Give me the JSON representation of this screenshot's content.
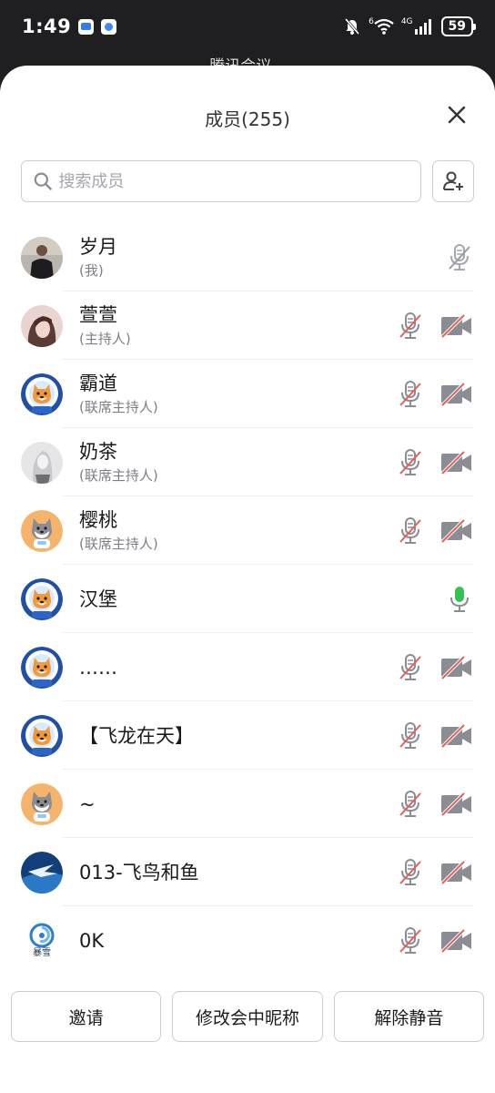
{
  "status_bar": {
    "time": "1:49",
    "net_label": "4G",
    "sim_label": "6",
    "battery": "59"
  },
  "behind_title": "腾讯会议",
  "sheet": {
    "title": "成员(255)",
    "search_placeholder": "搜索成员"
  },
  "members": [
    {
      "name": "岁月",
      "role": "(我)",
      "avatar": "photo-man",
      "mic": "muted-gray",
      "video": "none"
    },
    {
      "name": "萱萱",
      "role": "(主持人)",
      "avatar": "photo-girl",
      "mic": "muted",
      "video": "off"
    },
    {
      "name": "霸道",
      "role": "(联席主持人)",
      "avatar": "shiba-astronaut",
      "mic": "muted",
      "video": "off"
    },
    {
      "name": "奶茶",
      "role": "(联席主持人)",
      "avatar": "photo-gray",
      "mic": "muted",
      "video": "off"
    },
    {
      "name": "樱桃",
      "role": "(联席主持人)",
      "avatar": "shiba-orange",
      "mic": "muted",
      "video": "off"
    },
    {
      "name": "汉堡",
      "role": "",
      "avatar": "shiba-astronaut",
      "mic": "active",
      "video": "none"
    },
    {
      "name": "……",
      "role": "",
      "avatar": "shiba-astronaut",
      "mic": "muted",
      "video": "off"
    },
    {
      "name": "【飞龙在天】",
      "role": "",
      "avatar": "shiba-astronaut",
      "mic": "muted",
      "video": "off"
    },
    {
      "name": "~",
      "role": "",
      "avatar": "shiba-orange",
      "mic": "muted",
      "video": "off"
    },
    {
      "name": "013-飞鸟和鱼",
      "role": "",
      "avatar": "bird-blue",
      "mic": "muted",
      "video": "off"
    },
    {
      "name": "0K",
      "role": "",
      "avatar": "blizzard-logo",
      "avatar_text": "暴雪",
      "mic": "muted",
      "video": "off"
    }
  ],
  "footer": {
    "invite": "邀请",
    "rename": "修改会中昵称",
    "unmute": "解除静音"
  },
  "colors": {
    "muted_slash": "#e0605a",
    "icon_gray": "#8a8d93",
    "mic_active": "#35c255",
    "border": "#c9ccd2"
  }
}
